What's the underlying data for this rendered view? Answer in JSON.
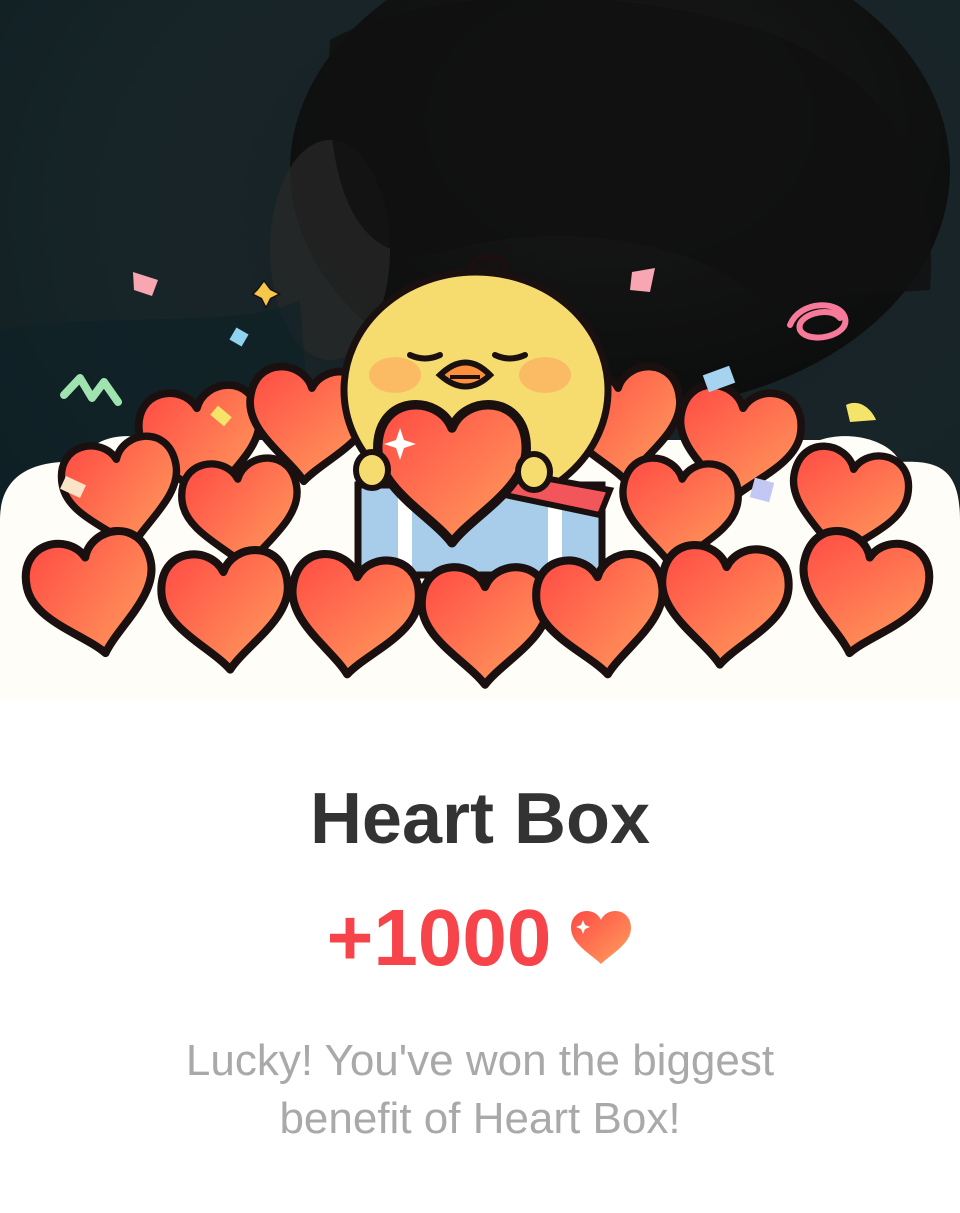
{
  "dialog": {
    "title": "Heart Box",
    "reward_amount": "+1000",
    "reward_icon": "heart-icon",
    "message": "Lucky! You've won the biggest benefit of Heart Box!"
  },
  "illustration": {
    "character": "yellow-chick-holding-heart",
    "background": "dark-photo",
    "decorations": [
      "hearts-pile",
      "confetti",
      "gift-box"
    ]
  },
  "colors": {
    "accent": "#f7434a",
    "title": "#333333",
    "message": "#a9a9a9",
    "heart_light": "#ff9a5c",
    "heart_dark": "#ff4d44",
    "chick": "#f6dc6e"
  }
}
